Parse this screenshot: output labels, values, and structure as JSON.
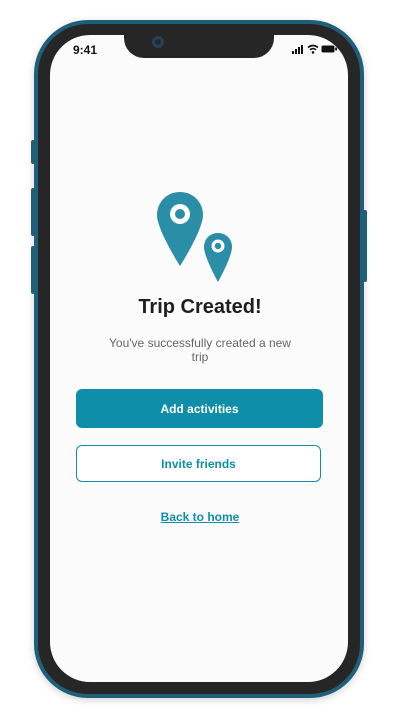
{
  "status_bar": {
    "time": "9:41",
    "icons": [
      "signal-icon",
      "wifi-icon",
      "battery-icon"
    ]
  },
  "illustration": {
    "icon": "map-pin-icon",
    "accent_color": "#2a8ea6"
  },
  "content": {
    "title": "Trip Created!",
    "subtitle": "You've successfully created a new trip"
  },
  "actions": {
    "primary_label": "Add activities",
    "secondary_label": "Invite friends",
    "link_label": "Back to home"
  },
  "colors": {
    "primary": "#0f8ea9",
    "frame": "#1f5f7a",
    "screen_bg": "#fbfbfb"
  }
}
